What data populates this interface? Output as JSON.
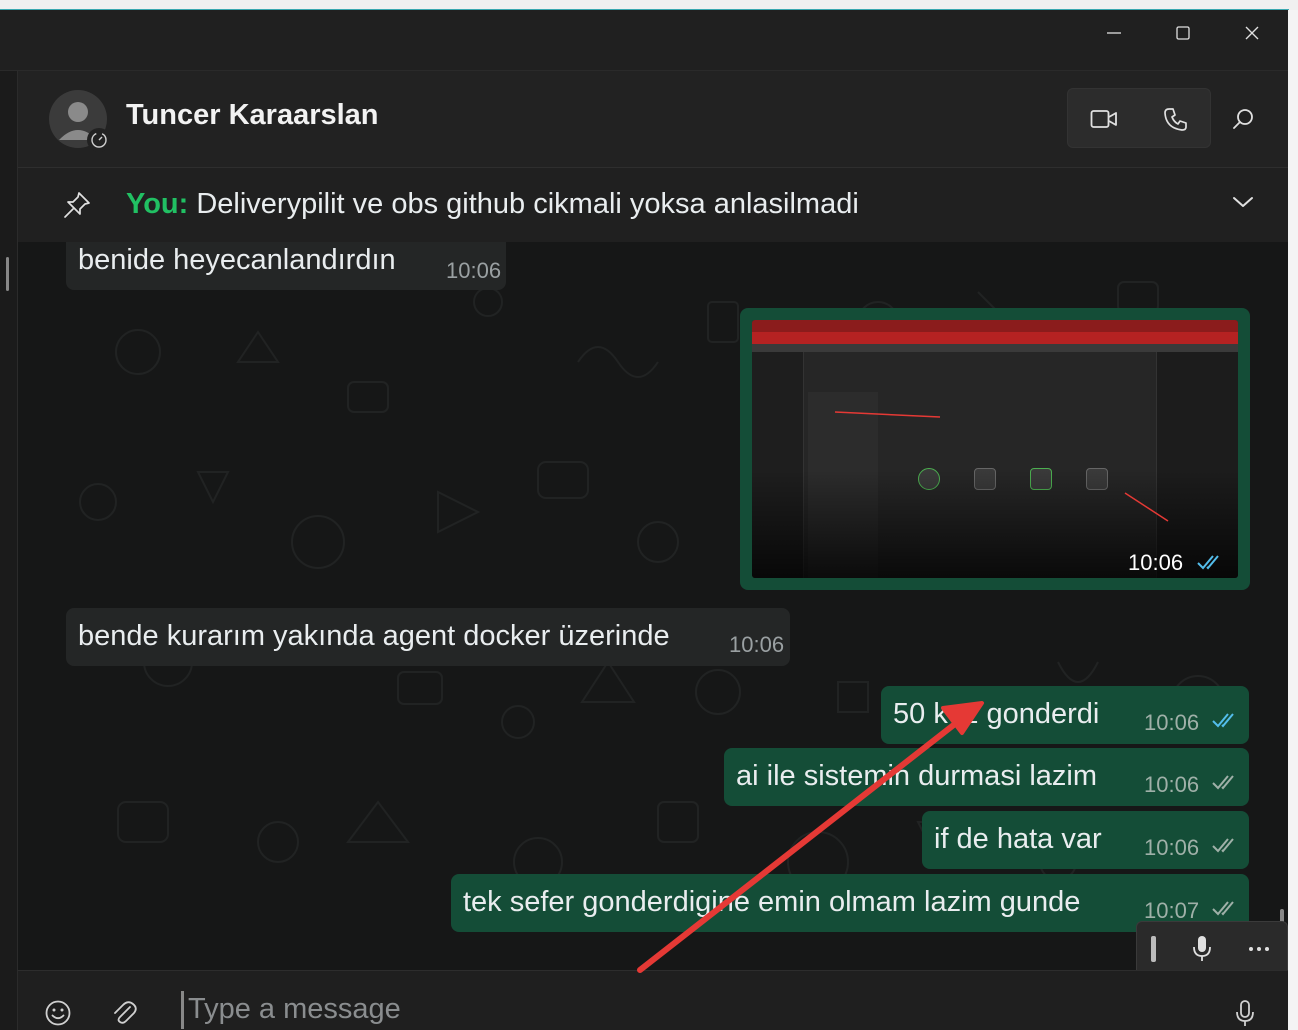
{
  "window": {
    "controls": {
      "minimize": "minimize",
      "maximize": "maximize",
      "close": "close"
    }
  },
  "header": {
    "contact_name": "Tuncer Karaarslan",
    "icons": [
      "video-call-icon",
      "voice-call-icon",
      "search-icon"
    ]
  },
  "pinned": {
    "sender": "You:",
    "text": " Deliverypilit ve obs github cikmali yoksa anlasilmadi"
  },
  "messages": [
    {
      "direction": "in",
      "text": "benide heyecanlandırdın",
      "time": "10:06"
    },
    {
      "direction": "out",
      "type": "image",
      "time": "10:06",
      "status": "read"
    },
    {
      "direction": "in",
      "text": "bende kurarım yakında agent docker üzerinde",
      "time": "10:06"
    },
    {
      "direction": "out",
      "text": "50 kez gonderdi",
      "time": "10:06",
      "status": "read"
    },
    {
      "direction": "out",
      "text": "ai ile sistemin durmasi lazim",
      "time": "10:06",
      "status": "delivered"
    },
    {
      "direction": "out",
      "text": "if de hata var",
      "time": "10:06",
      "status": "delivered"
    },
    {
      "direction": "out",
      "text": "tek sefer gonderdigine emin olmam lazim gunde",
      "time": "10:07",
      "status": "delivered"
    }
  ],
  "composer": {
    "placeholder": "Type a message"
  },
  "colors": {
    "accent_green": "#21c063",
    "outgoing_bubble": "#144d37",
    "incoming_bubble": "#242626",
    "read_tick": "#53bdeb",
    "annotation_arrow": "#e53935"
  }
}
